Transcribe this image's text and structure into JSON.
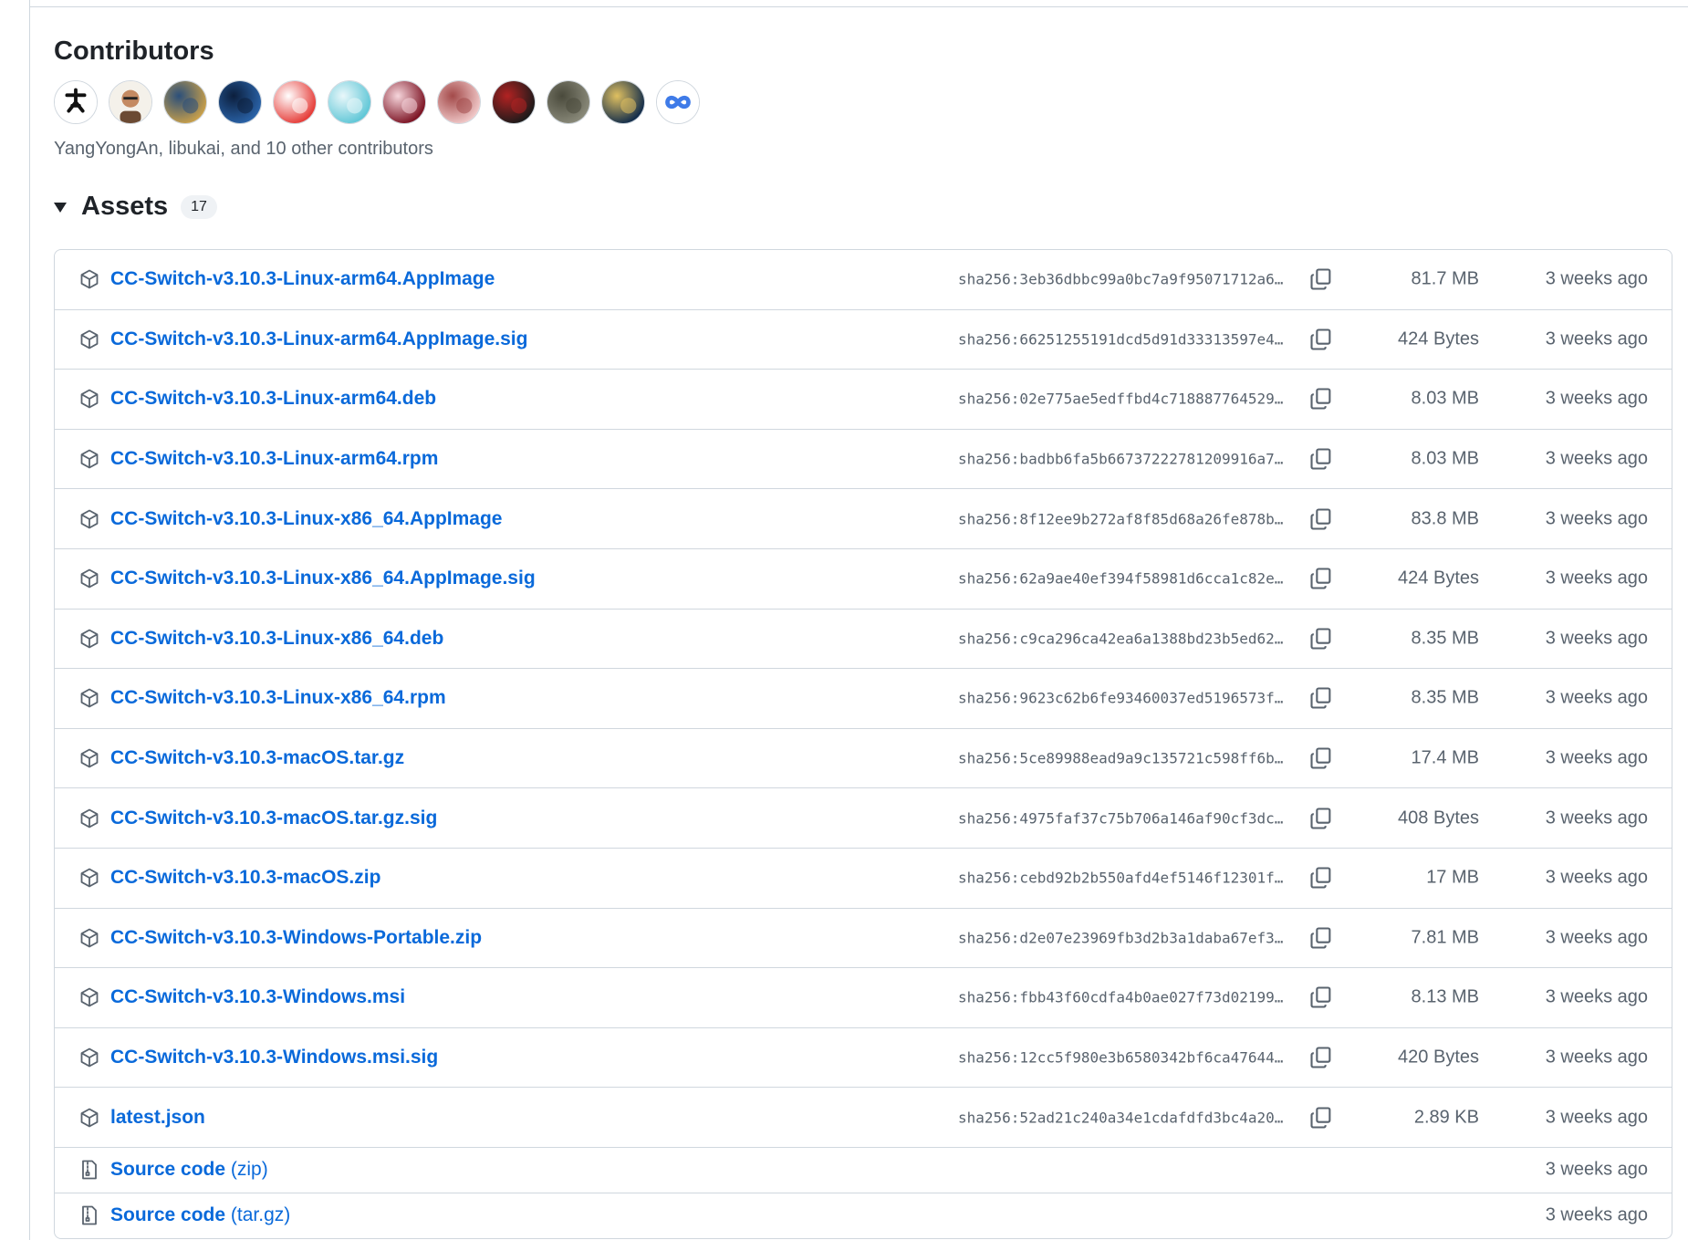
{
  "contributors": {
    "title": "Contributors",
    "summary": "YangYongAn, libukai, and 10 other contributors",
    "avatars": [
      {
        "name": "avatar-1",
        "colors": [
          "#ffffff",
          "#111111"
        ]
      },
      {
        "name": "avatar-2",
        "colors": [
          "#f4f1ea",
          "#6b4a33"
        ]
      },
      {
        "name": "avatar-3",
        "colors": [
          "#c9a04a",
          "#2b4f7a"
        ]
      },
      {
        "name": "avatar-4",
        "colors": [
          "#2a63a8",
          "#0c1f3d"
        ]
      },
      {
        "name": "avatar-5",
        "colors": [
          "#e53935",
          "#ffffff"
        ]
      },
      {
        "name": "avatar-6",
        "colors": [
          "#5ec6d6",
          "#e9f7fa"
        ]
      },
      {
        "name": "avatar-7",
        "colors": [
          "#7a1020",
          "#f6d6dc"
        ]
      },
      {
        "name": "avatar-8",
        "colors": [
          "#f1c9c9",
          "#a34a4a"
        ]
      },
      {
        "name": "avatar-9",
        "colors": [
          "#1a1a1a",
          "#b22222"
        ]
      },
      {
        "name": "avatar-10",
        "colors": [
          "#8a8a7a",
          "#4a4a3c"
        ]
      },
      {
        "name": "avatar-11",
        "colors": [
          "#0f2a4a",
          "#e0c060"
        ]
      },
      {
        "name": "avatar-12",
        "colors": [
          "#ffffff",
          "#3f7be8"
        ]
      }
    ]
  },
  "assets": {
    "title": "Assets",
    "count": "17",
    "items": [
      {
        "name": "CC-Switch-v3.10.3-Linux-arm64.AppImage",
        "sha": "sha256:3eb36dbbc99a0bc7a9f95071712a6…",
        "size": "81.7 MB",
        "time": "3 weeks ago"
      },
      {
        "name": "CC-Switch-v3.10.3-Linux-arm64.AppImage.sig",
        "sha": "sha256:66251255191dcd5d91d33313597e4…",
        "size": "424 Bytes",
        "time": "3 weeks ago"
      },
      {
        "name": "CC-Switch-v3.10.3-Linux-arm64.deb",
        "sha": "sha256:02e775ae5edffbd4c718887764529…",
        "size": "8.03 MB",
        "time": "3 weeks ago"
      },
      {
        "name": "CC-Switch-v3.10.3-Linux-arm64.rpm",
        "sha": "sha256:badbb6fa5b66737222781209916a7…",
        "size": "8.03 MB",
        "time": "3 weeks ago"
      },
      {
        "name": "CC-Switch-v3.10.3-Linux-x86_64.AppImage",
        "sha": "sha256:8f12ee9b272af8f85d68a26fe878b…",
        "size": "83.8 MB",
        "time": "3 weeks ago"
      },
      {
        "name": "CC-Switch-v3.10.3-Linux-x86_64.AppImage.sig",
        "sha": "sha256:62a9ae40ef394f58981d6cca1c82e…",
        "size": "424 Bytes",
        "time": "3 weeks ago"
      },
      {
        "name": "CC-Switch-v3.10.3-Linux-x86_64.deb",
        "sha": "sha256:c9ca296ca42ea6a1388bd23b5ed62…",
        "size": "8.35 MB",
        "time": "3 weeks ago"
      },
      {
        "name": "CC-Switch-v3.10.3-Linux-x86_64.rpm",
        "sha": "sha256:9623c62b6fe93460037ed5196573f…",
        "size": "8.35 MB",
        "time": "3 weeks ago"
      },
      {
        "name": "CC-Switch-v3.10.3-macOS.tar.gz",
        "sha": "sha256:5ce89988ead9a9c135721c598ff6b…",
        "size": "17.4 MB",
        "time": "3 weeks ago"
      },
      {
        "name": "CC-Switch-v3.10.3-macOS.tar.gz.sig",
        "sha": "sha256:4975faf37c75b706a146af90cf3dc…",
        "size": "408 Bytes",
        "time": "3 weeks ago"
      },
      {
        "name": "CC-Switch-v3.10.3-macOS.zip",
        "sha": "sha256:cebd92b2b550afd4ef5146f12301f…",
        "size": "17 MB",
        "time": "3 weeks ago"
      },
      {
        "name": "CC-Switch-v3.10.3-Windows-Portable.zip",
        "sha": "sha256:d2e07e23969fb3d2b3a1daba67ef3…",
        "size": "7.81 MB",
        "time": "3 weeks ago"
      },
      {
        "name": "CC-Switch-v3.10.3-Windows.msi",
        "sha": "sha256:fbb43f60cdfa4b0ae027f73d02199…",
        "size": "8.13 MB",
        "time": "3 weeks ago"
      },
      {
        "name": "CC-Switch-v3.10.3-Windows.msi.sig",
        "sha": "sha256:12cc5f980e3b6580342bf6ca47644…",
        "size": "420 Bytes",
        "time": "3 weeks ago"
      },
      {
        "name": "latest.json",
        "sha": "sha256:52ad21c240a34e1cdafdfd3bc4a20…",
        "size": "2.89 KB",
        "time": "3 weeks ago"
      }
    ],
    "source": [
      {
        "name": "Source code",
        "ext": "(zip)",
        "time": "3 weeks ago"
      },
      {
        "name": "Source code",
        "ext": "(tar.gz)",
        "time": "3 weeks ago"
      }
    ]
  },
  "colors": {
    "link": "#0969da",
    "muted": "#59636e",
    "border": "#d0d7de"
  }
}
